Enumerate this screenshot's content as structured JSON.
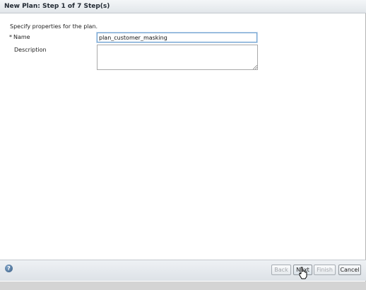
{
  "dialog": {
    "title": "New Plan: Step 1 of 7 Step(s)",
    "intro_text": "Specify properties for the plan."
  },
  "form": {
    "required_marker": "*",
    "name_label": "Name",
    "name_value": "plan_customer_masking",
    "description_label": "Description",
    "description_value": ""
  },
  "footer": {
    "help_icon": "help-icon",
    "help_glyph": "?",
    "back_label": "Back",
    "next_label": "Next",
    "finish_label": "Finish",
    "cancel_label": "Cancel"
  },
  "colors": {
    "title_bar": "#e2e6ea",
    "input_focus_border": "#6d9fcf",
    "disabled_text": "#a3a7ab"
  }
}
